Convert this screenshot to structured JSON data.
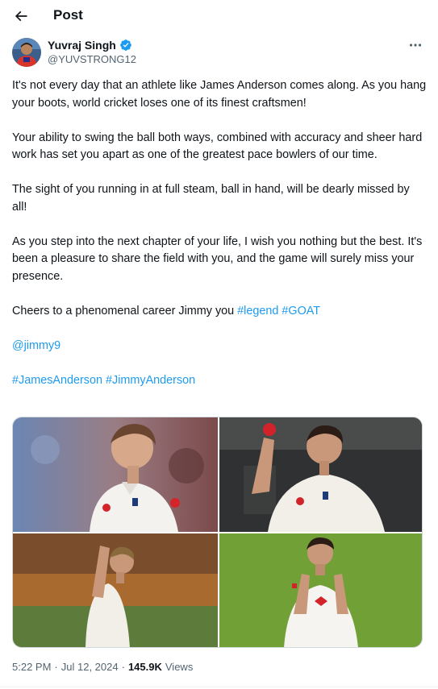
{
  "header": {
    "title": "Post"
  },
  "author": {
    "name": "Yuvraj Singh",
    "handle": "@YUVSTRONG12",
    "verified_color": "#1d9bf0"
  },
  "tweet": {
    "p1": "It's not every day that an athlete like James Anderson comes along. As you hang your boots, world cricket loses one of its finest craftsmen!",
    "p2": "Your ability to swing the ball both ways, combined with accuracy and sheer hard work has set you apart as one of the greatest pace bowlers of our time.",
    "p3": "The sight of you running in at full steam, ball in hand, will be dearly missed by all!",
    "p4": "As you step into the next chapter of your life, I wish you nothing but the best. It's been a pleasure to share the field with you, and the game will surely miss your presence.",
    "p5_text": "Cheers to a phenomenal career Jimmy you ",
    "hashtag_legend": "#legend",
    "hashtag_goat": "#GOAT",
    "mention": "@jimmy9",
    "hashtag_jamesanderson": "#JamesAnderson",
    "hashtag_jimmyanderson": "#JimmyAnderson"
  },
  "media": {
    "photos": [
      {
        "label": "James Anderson portrait in England whites"
      },
      {
        "label": "James Anderson holding up a red ball"
      },
      {
        "label": "James Anderson raising his arm on field"
      },
      {
        "label": "James Anderson celebrating on field"
      }
    ]
  },
  "meta": {
    "time": "5:22 PM",
    "separator1": "·",
    "date": "Jul 12, 2024",
    "separator2": "·",
    "views_count": "145.9K",
    "views_label": "Views"
  },
  "colors": {
    "link": "#1d9bf0",
    "secondary_text": "#536471",
    "primary_text": "#0f1419"
  }
}
